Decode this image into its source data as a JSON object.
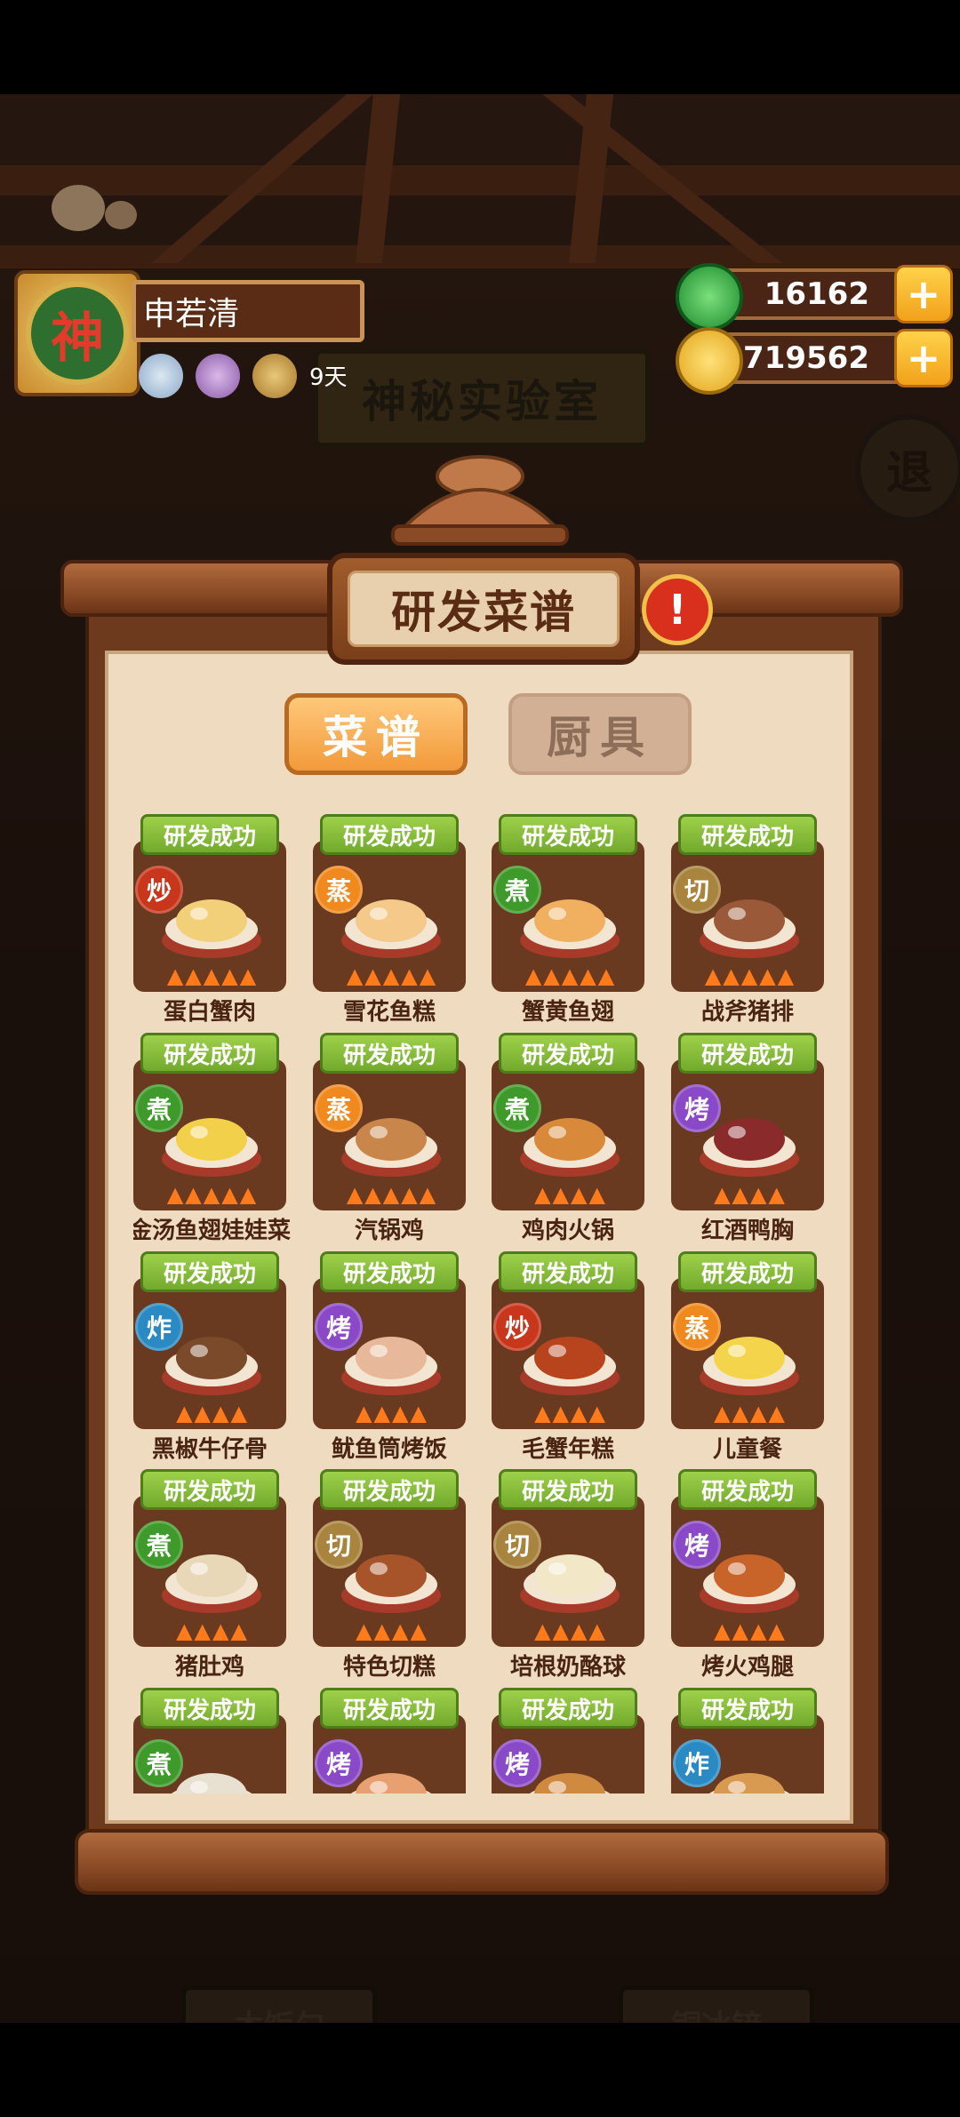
{
  "background": {
    "room_sign": "神秘实验室",
    "exit_label": "退",
    "bottom_plates": [
      "木饭勺",
      "铜冰铲"
    ]
  },
  "player": {
    "avatar_char": "神",
    "name": "申若清",
    "days": "9天"
  },
  "currency": {
    "jade": "16162",
    "coins": "85719562"
  },
  "panel": {
    "title": "研发菜谱",
    "info_label": "!",
    "tabs": [
      {
        "label": "菜谱",
        "active": true
      },
      {
        "label": "厨具",
        "active": false
      }
    ]
  },
  "badge_colors": {
    "炒": "#c8361c",
    "蒸": "#f08a1e",
    "煮": "#3e9a2a",
    "切": "#a8843e",
    "烤": "#8a4ac8",
    "炸": "#2a8ac4"
  },
  "recipes": [
    {
      "status": "研发成功",
      "method": "炒",
      "name": "蛋白蟹肉",
      "stars": 5,
      "dish_color": "#f2d07a"
    },
    {
      "status": "研发成功",
      "method": "蒸",
      "name": "雪花鱼糕",
      "stars": 5,
      "dish_color": "#f4c98a"
    },
    {
      "status": "研发成功",
      "method": "煮",
      "name": "蟹黄鱼翅",
      "stars": 5,
      "dish_color": "#f0b060"
    },
    {
      "status": "研发成功",
      "method": "切",
      "name": "战斧猪排",
      "stars": 5,
      "dish_color": "#9a5a3a"
    },
    {
      "status": "研发成功",
      "method": "煮",
      "name": "金汤鱼翅娃娃菜",
      "stars": 5,
      "dish_color": "#f2d04a"
    },
    {
      "status": "研发成功",
      "method": "蒸",
      "name": "汽锅鸡",
      "stars": 5,
      "dish_color": "#c8864a"
    },
    {
      "status": "研发成功",
      "method": "煮",
      "name": "鸡肉火锅",
      "stars": 4,
      "dish_color": "#d88a3a"
    },
    {
      "status": "研发成功",
      "method": "烤",
      "name": "红酒鸭胸",
      "stars": 4,
      "dish_color": "#8a2a2a"
    },
    {
      "status": "研发成功",
      "method": "炸",
      "name": "黑椒牛仔骨",
      "stars": 4,
      "dish_color": "#7a4a2a"
    },
    {
      "status": "研发成功",
      "method": "烤",
      "name": "鱿鱼筒烤饭",
      "stars": 4,
      "dish_color": "#e8b89a"
    },
    {
      "status": "研发成功",
      "method": "炒",
      "name": "毛蟹年糕",
      "stars": 4,
      "dish_color": "#b8441e"
    },
    {
      "status": "研发成功",
      "method": "蒸",
      "name": "儿童餐",
      "stars": 4,
      "dish_color": "#f4d44a"
    },
    {
      "status": "研发成功",
      "method": "煮",
      "name": "猪肚鸡",
      "stars": 4,
      "dish_color": "#e8d8b8"
    },
    {
      "status": "研发成功",
      "method": "切",
      "name": "特色切糕",
      "stars": 4,
      "dish_color": "#a8542a"
    },
    {
      "status": "研发成功",
      "method": "切",
      "name": "培根奶酪球",
      "stars": 4,
      "dish_color": "#f2e8c8"
    },
    {
      "status": "研发成功",
      "method": "烤",
      "name": "烤火鸡腿",
      "stars": 4,
      "dish_color": "#c8642a"
    },
    {
      "status": "研发成功",
      "method": "煮",
      "name": "",
      "stars": 0,
      "dish_color": "#e8e0d0"
    },
    {
      "status": "研发成功",
      "method": "烤",
      "name": "",
      "stars": 0,
      "dish_color": "#e8a070"
    },
    {
      "status": "研发成功",
      "method": "烤",
      "name": "",
      "stars": 0,
      "dish_color": "#d08a40"
    },
    {
      "status": "研发成功",
      "method": "炸",
      "name": "",
      "stars": 0,
      "dish_color": "#d89a50"
    }
  ]
}
